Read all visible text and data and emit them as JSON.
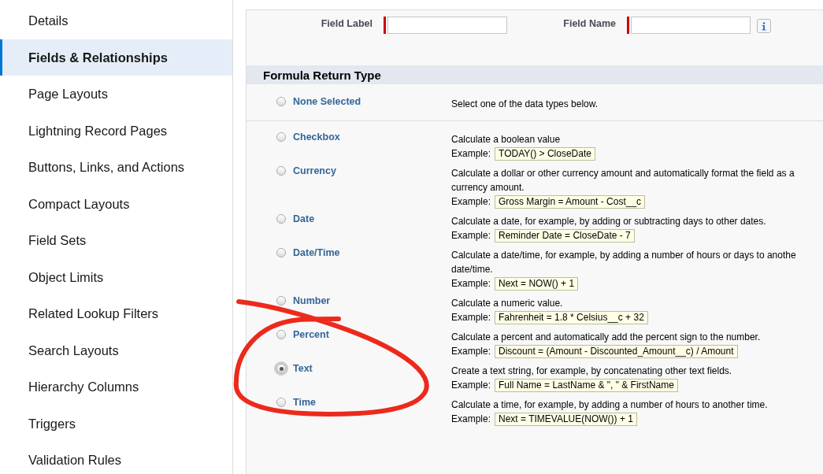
{
  "sidebar": {
    "items": [
      {
        "label": "Details",
        "selected": false
      },
      {
        "label": "Fields & Relationships",
        "selected": true
      },
      {
        "label": "Page Layouts",
        "selected": false
      },
      {
        "label": "Lightning Record Pages",
        "selected": false
      },
      {
        "label": "Buttons, Links, and Actions",
        "selected": false
      },
      {
        "label": "Compact Layouts",
        "selected": false
      },
      {
        "label": "Field Sets",
        "selected": false
      },
      {
        "label": "Object Limits",
        "selected": false
      },
      {
        "label": "Related Lookup Filters",
        "selected": false
      },
      {
        "label": "Search Layouts",
        "selected": false
      },
      {
        "label": "Hierarchy Columns",
        "selected": false
      },
      {
        "label": "Triggers",
        "selected": false
      },
      {
        "label": "Validation Rules",
        "selected": false
      }
    ]
  },
  "fields": [
    {
      "label": "Field Label",
      "required": true
    },
    {
      "label": "Field Name",
      "required": true
    }
  ],
  "section": {
    "title": "Formula Return Type"
  },
  "none_option": {
    "label": "None Selected",
    "selected": false,
    "description": [
      "Select one of the data types below."
    ]
  },
  "types": [
    {
      "label": "Checkbox",
      "selected": false,
      "description": [
        "Calculate a boolean value"
      ],
      "example_label": "Example:",
      "example": "TODAY() > CloseDate"
    },
    {
      "label": "Currency",
      "selected": false,
      "description": [
        "Calculate a dollar or other currency amount and automatically format the field as a",
        "currency amount."
      ],
      "example_label": "Example:",
      "example": "Gross Margin = Amount - Cost__c"
    },
    {
      "label": "Date",
      "selected": false,
      "description": [
        "Calculate a date, for example, by adding or subtracting days to other dates."
      ],
      "example_label": "Example:",
      "example": "Reminder Date = CloseDate - 7"
    },
    {
      "label": "Date/Time",
      "selected": false,
      "description": [
        "Calculate a date/time, for example, by adding a number of hours or days to anothe",
        "date/time."
      ],
      "example_label": "Example:",
      "example": "Next = NOW() + 1"
    },
    {
      "label": "Number",
      "selected": false,
      "description": [
        "Calculate a numeric value."
      ],
      "example_label": "Example:",
      "example": "Fahrenheit = 1.8 * Celsius__c + 32"
    },
    {
      "label": "Percent",
      "selected": false,
      "description": [
        "Calculate a percent and automatically add the percent sign to the number."
      ],
      "example_label": "Example:",
      "example": "Discount = (Amount - Discounted_Amount__c) / Amount"
    },
    {
      "label": "Text",
      "selected": true,
      "description": [
        "Create a text string, for example, by concatenating other text fields."
      ],
      "example_label": "Example:",
      "example": "Full Name = LastName & \", \" & FirstName"
    },
    {
      "label": "Time",
      "selected": false,
      "description": [
        "Calculate a time, for example, by adding a number of hours to another time."
      ],
      "example_label": "Example:",
      "example": "Next = TIMEVALUE(NOW()) + 1"
    }
  ]
}
